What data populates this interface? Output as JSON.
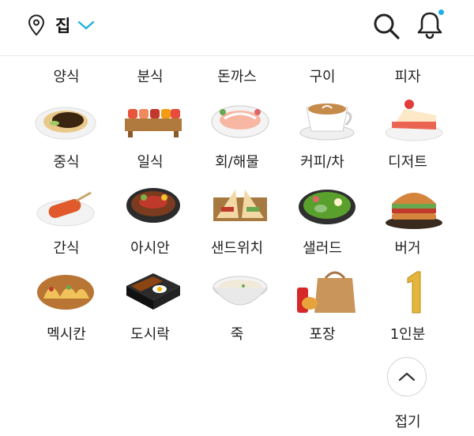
{
  "header": {
    "location_name": "집",
    "icons": {
      "location": "location-pin-icon",
      "dropdown": "chevron-down-icon",
      "search": "search-icon",
      "notifications": "bell-icon"
    },
    "accent_color": "#21b0e4"
  },
  "categories": [
    {
      "label": "양식",
      "image": "western-food-image"
    },
    {
      "label": "분식",
      "image": "snack-food-image"
    },
    {
      "label": "돈까스",
      "image": "pork-cutlet-image"
    },
    {
      "label": "구이",
      "image": "grill-image"
    },
    {
      "label": "피자",
      "image": "pizza-image"
    },
    {
      "label": "중식",
      "image": "chinese-food-image"
    },
    {
      "label": "일식",
      "image": "japanese-food-image"
    },
    {
      "label": "회/해물",
      "image": "sashimi-seafood-image"
    },
    {
      "label": "커피/차",
      "image": "coffee-tea-image"
    },
    {
      "label": "디저트",
      "image": "dessert-image"
    },
    {
      "label": "간식",
      "image": "corn-dog-snack-image"
    },
    {
      "label": "아시안",
      "image": "asian-noodle-image"
    },
    {
      "label": "샌드위치",
      "image": "sandwich-image"
    },
    {
      "label": "샐러드",
      "image": "salad-image"
    },
    {
      "label": "버거",
      "image": "burger-image"
    },
    {
      "label": "멕시칸",
      "image": "tacos-image"
    },
    {
      "label": "도시락",
      "image": "lunchbox-image"
    },
    {
      "label": "죽",
      "image": "porridge-image"
    },
    {
      "label": "포장",
      "image": "takeout-image"
    },
    {
      "label": "1인분",
      "image": "single-serving-image"
    }
  ],
  "collapse": {
    "label": "접기",
    "icon": "chevron-up-icon"
  }
}
